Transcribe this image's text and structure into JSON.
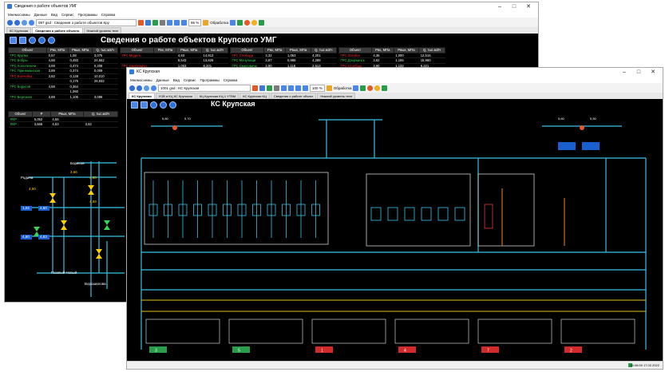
{
  "back_window": {
    "title": "Сведения о работе объектов УМГ",
    "menu": [
      "Мнемосхемы",
      "Данные",
      "Вид",
      "Сервис",
      "Программы",
      "Справка"
    ],
    "address": "097 gsd : Сведения о работе объектов Кру",
    "zoom": "95 %",
    "toolbar_text": "Обработка",
    "tabs": [
      "КС Крупская",
      "Сведения о работе объекто",
      "Нижний уровень техн"
    ],
    "header": "Сведения о работе объектов Крупского УМГ",
    "table1": {
      "columns": [
        "Объект",
        "Рвх, МПа",
        "Рвых, МПа",
        "Q, тыс.м3/ч"
      ],
      "rows": [
        {
          "name": "ГРС Крупки",
          "v1": "0,57",
          "v2": "1,08",
          "v3": "3,075",
          "color": "g"
        },
        {
          "name": "ГРС Бобры",
          "v1": "4,58",
          "v2": "0,483",
          "v3": "24,552",
          "color": "g"
        },
        {
          "name": "ГРС Холопеничи",
          "v1": "3,59",
          "v2": "0,474",
          "v3": "0,208",
          "color": "g"
        },
        {
          "name": "ГРС Принеманская",
          "v1": "3,89",
          "v2": "0,374",
          "v3": "0,009",
          "color": "g"
        },
        {
          "name": "ГРС Волчейка",
          "v1": "3,82",
          "v2": "0,128",
          "v3": "10,010",
          "color": "r"
        },
        {
          "name": "",
          "v1": "",
          "v2": "0,175",
          "v3": "26,932",
          "color": "w"
        },
        {
          "name": "ГРС Борисов",
          "v1": "4,58",
          "v2": "0,364",
          "v3": "",
          "color": "g"
        },
        {
          "name": "",
          "v1": "",
          "v2": "1,060",
          "v3": "",
          "color": "w"
        },
        {
          "name": "ГРС Березино",
          "v1": "3,89",
          "v2": "1,105",
          "v3": "3,086",
          "color": "g"
        }
      ]
    },
    "table2": {
      "columns": [
        "Объект",
        "P",
        "Рвых, МПа",
        "Q, тыс.м3/ч"
      ],
      "rows": [
        {
          "name": "ЯКР",
          "v1": "5,052",
          "v2": "4,55",
          "v3": ""
        },
        {
          "name": "ЯКР",
          "v1": "3,566",
          "v2": "4,53",
          "v3": "3,53"
        }
      ]
    },
    "table3": {
      "columns": [
        "Объект",
        "Рвх, МПа",
        "Рвых, МПа",
        "Q, тыс.м3/ч"
      ],
      "rows": [
        {
          "name": "ГРС Мядель",
          "v1": "",
          "v2": "4,93",
          "v3": "14,913",
          "color": "r"
        },
        {
          "name": "",
          "v1": "",
          "v2": "8,543",
          "v3": "13,826",
          "color": "y"
        },
        {
          "name": "ГРС Смолевичи",
          "v1": "",
          "v2": "1,003",
          "v3": "8,201",
          "color": "r"
        }
      ]
    },
    "table4": {
      "columns": [
        "Объект",
        "Рвх, МПа",
        "Рвых, МПа",
        "Q, тыс.м3/ч"
      ],
      "rows": [
        {
          "name": "ГРС Слобода",
          "v1": "3,32",
          "v2": "1,053",
          "v3": "4,201",
          "color": "r"
        },
        {
          "name": "ГРС Мачулищи",
          "v1": "3,87",
          "v2": "0,988",
          "v3": "4,288",
          "color": "g"
        },
        {
          "name": "ГРС Смиловичи",
          "v1": "3,90",
          "v2": "1,115",
          "v3": "2,513",
          "color": "g"
        }
      ]
    },
    "table5": {
      "columns": [
        "Объект",
        "Рвх, МПа",
        "Рвых, МПа",
        "Q, тыс.м3/ч"
      ],
      "rows": [
        {
          "name": "ГРС Логойск",
          "v1": "4,35",
          "v2": "1,000",
          "v3": "12,515",
          "color": "r"
        },
        {
          "name": "ГРС Дзержинск",
          "v1": "3,62",
          "v2": "1,155",
          "v3": "15,960",
          "color": "g"
        },
        {
          "name": "ГРС Столбцы",
          "v1": "3,90",
          "v2": "1,132",
          "v3": "6,221",
          "color": "r"
        }
      ]
    },
    "scheme_labels": {
      "top": "Борисов",
      "left": "Родина",
      "bottom": "Газовый Новый",
      "right_bottom": "Ворошилова",
      "val1": "3,56",
      "val2": "4,60",
      "val3": "4,50",
      "val4": "1,04",
      "val5": "4,60",
      "val6": "4,89",
      "val7": "4,80",
      "val8": "4,83"
    },
    "colors": {
      "canvas": "#000000",
      "accent": "#2f6fd6",
      "pipe": "#35c2e6",
      "valve": "#ffd000"
    }
  },
  "front_window": {
    "title": "КС Крупская",
    "menu": [
      "Мнемосхемы",
      "Данные",
      "Вид",
      "Сервис",
      "Программы",
      "Справка"
    ],
    "address": "1001 gsd : КС Крупская",
    "zoom": "100 %",
    "toolbar_text": "Обработка",
    "tabs": [
      "КС Крупская",
      "УОВ и КЦ КС Крупская",
      "КЦ Крупская КЦ-1 УТВМ",
      "КС Крупская КЦ",
      "Сведения о работе объект",
      "Нижний уровень техн"
    ],
    "header": "КС Крупская",
    "top_labels": {
      "left_val1": "5,80",
      "left_val2": "5,70",
      "right_val1": "5,60",
      "right_val2": "5,50"
    },
    "unit_values": [
      "3",
      "5",
      "1",
      "4",
      "7",
      "2"
    ],
    "status_time": "16:06:59  17.02.2022"
  }
}
